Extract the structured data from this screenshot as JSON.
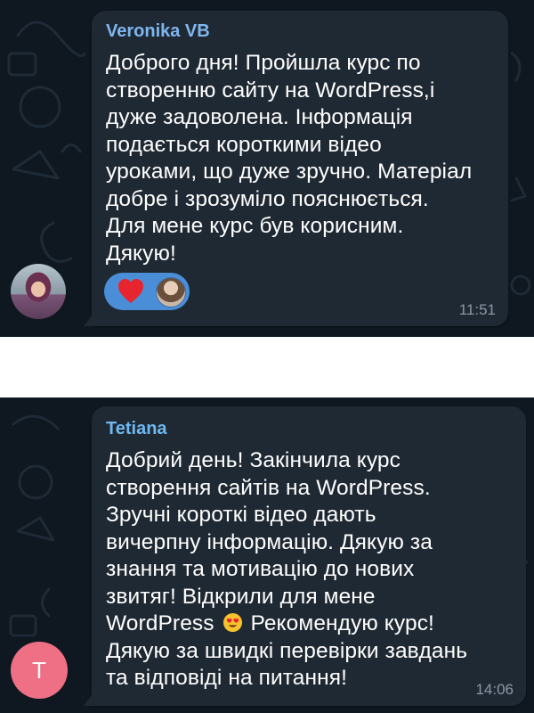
{
  "messages": [
    {
      "sender": "Veronika VB",
      "lines": [
        "Доброго дня! Пройшла курс по",
        "створенню сайту на WordPress,і",
        "дуже задоволена. Інформація",
        "подається короткими відео",
        "уроками, що дуже зручно. Матеріал",
        "добре і зрозуміло пояснюється.",
        "Для мене курс був корисним.",
        "Дякую!"
      ],
      "time": "11:51",
      "reactions": [
        "heart-icon",
        "reactor-avatar"
      ],
      "avatar": "photo"
    },
    {
      "sender": "Tetiana",
      "lines": [
        "Добрий день! Закінчила курс",
        "створення сайтів на WordPress.",
        "Зручні короткі відео дають",
        "вичерпну інформацію. Дякую за",
        "знання та мотивацію до нових",
        "звитяг!  Відкрили для мене",
        "WordPress",
        "Рекомендую курс!",
        "Дякую за швидкі перевірки завдань",
        "та відповіді на питання!"
      ],
      "time": "14:06",
      "avatar_letter": "T",
      "avatar_color": "#ef6f84",
      "inline_emoji": "heart-eyes-emoji"
    }
  ],
  "colors": {
    "background": "#0f1720",
    "bubble": "#1f2933",
    "sender_name": "#7fb6ef",
    "reaction_pill": "#4a8ed8",
    "timestamp": "#8a98a6"
  }
}
